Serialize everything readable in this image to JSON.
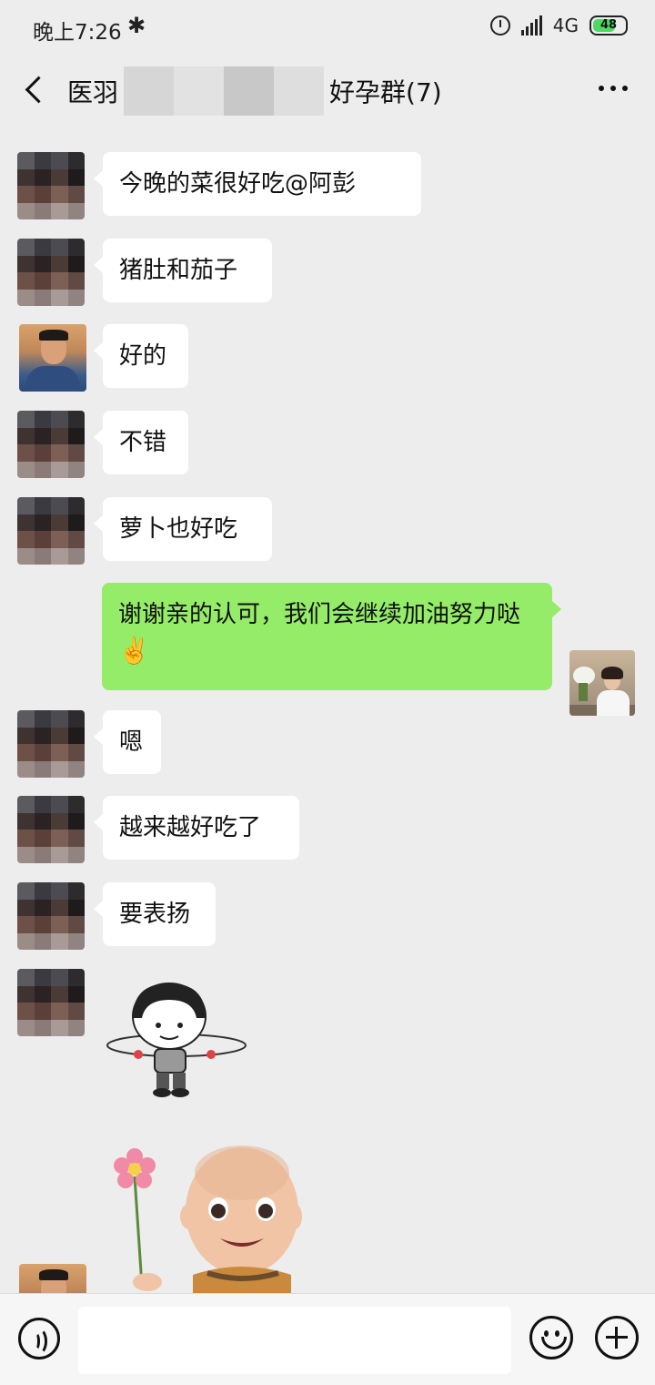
{
  "status_bar": {
    "time": "晚上7:26",
    "network": "4G",
    "battery": "48",
    "bluetooth_icon": "bluetooth-icon",
    "alarm_icon": "alarm-icon"
  },
  "header": {
    "title_prefix": "医羽",
    "title_suffix": "好孕群(7)",
    "back_icon": "chevron-left-icon",
    "more_icon": "more-dots-icon"
  },
  "messages": [
    {
      "text": "今晚的菜很好吃@阿彭"
    },
    {
      "text": "猪肚和茄子"
    },
    {
      "text": "好的"
    },
    {
      "text": "不错"
    },
    {
      "text": "萝卜也好吃"
    },
    {
      "text": "谢谢亲的认可，我们会继续加油努力哒",
      "emoji": "✌️"
    },
    {
      "text": "嗯"
    },
    {
      "text": "越来越好吃了"
    },
    {
      "text": "要表扬"
    }
  ],
  "colors": {
    "background": "#ededed",
    "my_bubble": "#95ec69",
    "other_bubble": "#ffffff"
  },
  "input_bar": {
    "voice_icon": "voice-icon",
    "emoji_icon": "emoji-icon",
    "plus_icon": "plus-icon"
  }
}
